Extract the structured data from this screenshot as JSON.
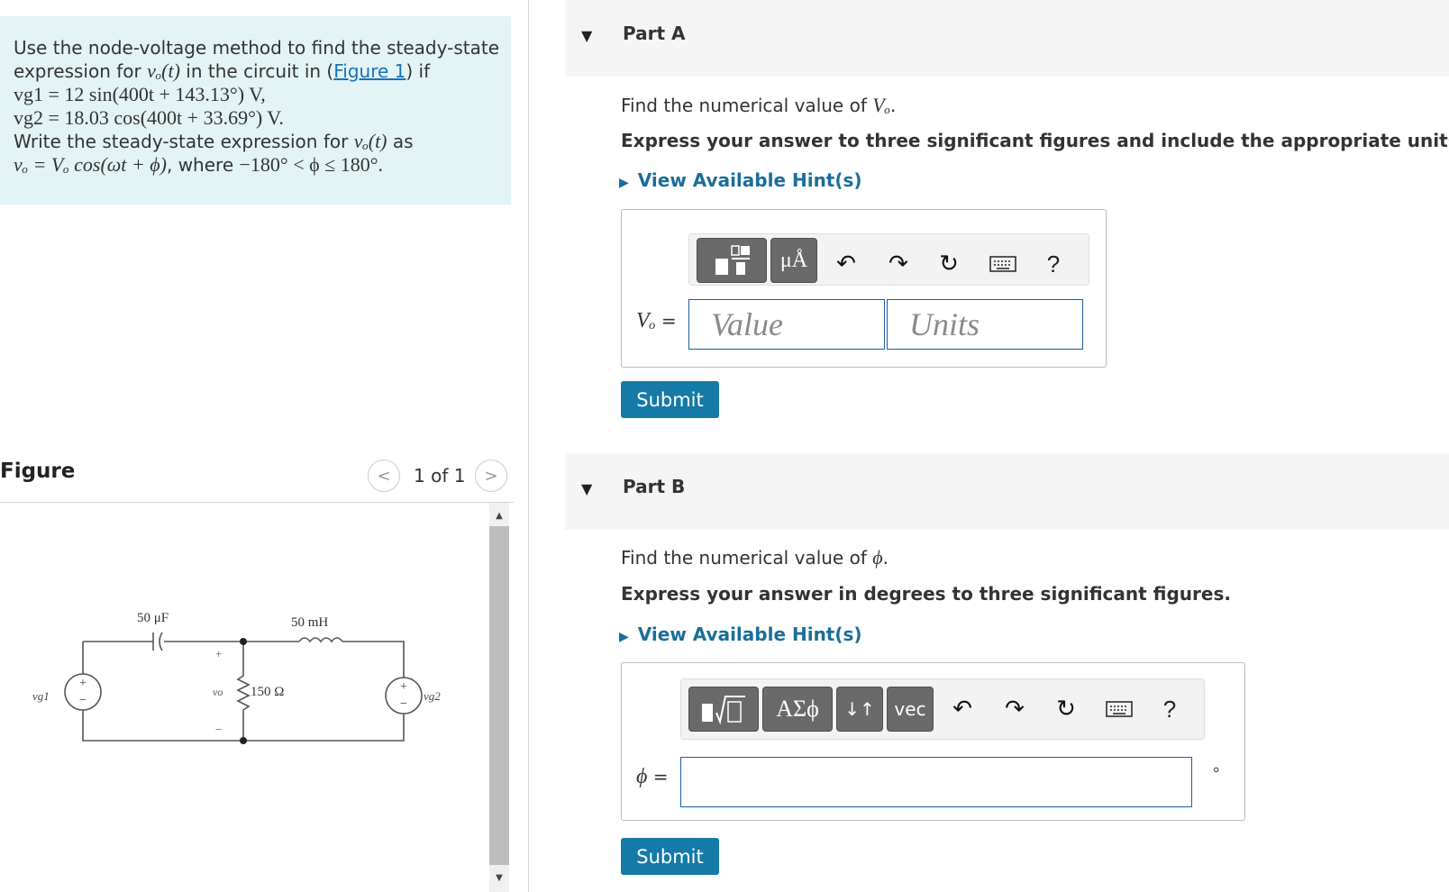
{
  "problem": {
    "line1": "Use the node-voltage method to find the steady-state",
    "line2_pre": "expression for ",
    "line2_math": "vₒ(t)",
    "line2_mid": " in the circuit in (",
    "figure_link": "Figure 1",
    "line2_post": ") if",
    "line3": "vg1 = 12 sin(400t + 143.13°) V,",
    "line4": "vg2 = 18.03 cos(400t + 33.69°) V.",
    "line5_pre": "Write the steady-state expression for ",
    "line5_math": "vₒ(t)",
    "line5_post": " as",
    "line6_math1": "vₒ = Vₒ cos(ωt + ϕ)",
    "line6_text": ", where ",
    "line6_math2": "−180° < ϕ ≤ 180°."
  },
  "figure": {
    "title": "Figure",
    "pager": "1 of 1",
    "prev_icon": "chevron-left-icon",
    "next_icon": "chevron-right-icon",
    "circuit": {
      "capacitor": "50 μF",
      "inductor": "50 mH",
      "resistor": "150 Ω",
      "source1": "vg1",
      "source2": "vg2",
      "output": "vo",
      "plus": "+",
      "minus": "−"
    }
  },
  "partA": {
    "label": "Part A",
    "question_pre": "Find the numerical value of ",
    "question_math": "Vₒ",
    "question_post": ".",
    "instruction": "Express your answer to three significant figures and include the appropriate units.",
    "hint": "View Available Hint(s)",
    "toolbar": {
      "template_icon": "template-icon",
      "units_label": "μÅ",
      "undo_icon": "undo-icon",
      "redo_icon": "redo-icon",
      "reset_icon": "reset-icon",
      "keyboard_icon": "keyboard-icon",
      "help": "?"
    },
    "field_label_math": "Vₒ",
    "field_label_eq": " =",
    "value_placeholder": "Value",
    "units_placeholder": "Units",
    "submit": "Submit"
  },
  "partB": {
    "label": "Part B",
    "question_pre": "Find the numerical value of ",
    "question_math": "ϕ",
    "question_post": ".",
    "instruction": "Express your answer in degrees to three significant figures.",
    "hint": "View Available Hint(s)",
    "toolbar": {
      "template_icon": "template-sqrt-icon",
      "greek_label": "ΑΣϕ",
      "arrows_label": "↓↑",
      "vec_label": "vec",
      "undo_icon": "undo-icon",
      "redo_icon": "redo-icon",
      "reset_icon": "reset-icon",
      "keyboard_icon": "keyboard-icon",
      "help": "?"
    },
    "field_label_math": "ϕ",
    "field_label_eq": " =",
    "unit_suffix": "∘",
    "submit": "Submit"
  },
  "colors": {
    "problem_bg": "#e3f4f6",
    "link": "#1a72b8",
    "hint": "#1a6e9a",
    "submit_bg": "#157aa8",
    "field_border": "#1a5fa4"
  }
}
